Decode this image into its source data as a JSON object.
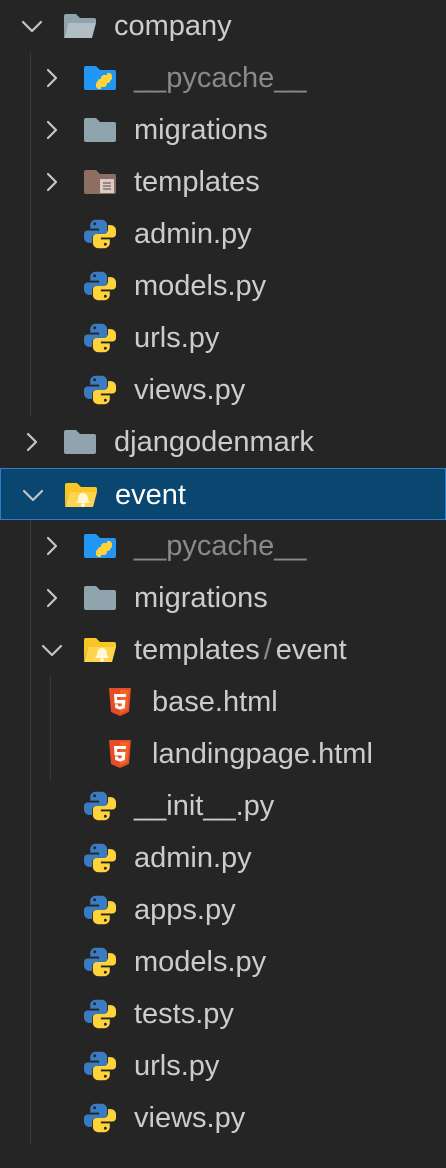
{
  "explorer": {
    "items": [
      {
        "name": "company",
        "type": "folder",
        "expanded": true,
        "depth": 0,
        "icon": "folder-open-icon"
      },
      {
        "name": "__pycache__",
        "type": "folder",
        "expanded": false,
        "depth": 1,
        "icon": "python-folder-icon",
        "dimmed": true
      },
      {
        "name": "migrations",
        "type": "folder",
        "expanded": false,
        "depth": 1,
        "icon": "folder-icon"
      },
      {
        "name": "templates",
        "type": "folder",
        "expanded": false,
        "depth": 1,
        "icon": "templates-folder-icon"
      },
      {
        "name": "admin.py",
        "type": "file",
        "depth": 1,
        "icon": "python-file-icon"
      },
      {
        "name": "models.py",
        "type": "file",
        "depth": 1,
        "icon": "python-file-icon"
      },
      {
        "name": "urls.py",
        "type": "file",
        "depth": 1,
        "icon": "python-file-icon"
      },
      {
        "name": "views.py",
        "type": "file",
        "depth": 1,
        "icon": "python-file-icon"
      },
      {
        "name": "djangodenmark",
        "type": "folder",
        "expanded": false,
        "depth": 0,
        "icon": "folder-icon"
      },
      {
        "name": "event",
        "type": "folder",
        "expanded": true,
        "depth": 0,
        "icon": "folder-open-yellow-icon",
        "selected": true
      },
      {
        "name": "__pycache__",
        "type": "folder",
        "expanded": false,
        "depth": 1,
        "icon": "python-folder-icon",
        "dimmed": true
      },
      {
        "name": "migrations",
        "type": "folder",
        "expanded": false,
        "depth": 1,
        "icon": "folder-icon"
      },
      {
        "name": "templates",
        "compact_child": "event",
        "type": "folder",
        "expanded": true,
        "depth": 1,
        "icon": "folder-open-yellow-icon"
      },
      {
        "name": "base.html",
        "type": "file",
        "depth": 2,
        "icon": "html5-file-icon"
      },
      {
        "name": "landingpage.html",
        "type": "file",
        "depth": 2,
        "icon": "html5-file-icon"
      },
      {
        "name": "__init__.py",
        "type": "file",
        "depth": 1,
        "icon": "python-file-icon"
      },
      {
        "name": "admin.py",
        "type": "file",
        "depth": 1,
        "icon": "python-file-icon"
      },
      {
        "name": "apps.py",
        "type": "file",
        "depth": 1,
        "icon": "python-file-icon"
      },
      {
        "name": "models.py",
        "type": "file",
        "depth": 1,
        "icon": "python-file-icon"
      },
      {
        "name": "tests.py",
        "type": "file",
        "depth": 1,
        "icon": "python-file-icon"
      },
      {
        "name": "urls.py",
        "type": "file",
        "depth": 1,
        "icon": "python-file-icon"
      },
      {
        "name": "views.py",
        "type": "file",
        "depth": 1,
        "icon": "python-file-icon"
      }
    ]
  },
  "colors": {
    "background": "#252526",
    "selection": "#094771",
    "selection_border": "#2c80c9",
    "text": "#cccccc",
    "text_dimmed": "#8a8a8a",
    "folder_grey": "#90a4ae",
    "folder_yellow": "#f9c623",
    "python_blue": "#3b7bbf",
    "python_yellow": "#ffd43b",
    "html_orange": "#e44d26"
  }
}
